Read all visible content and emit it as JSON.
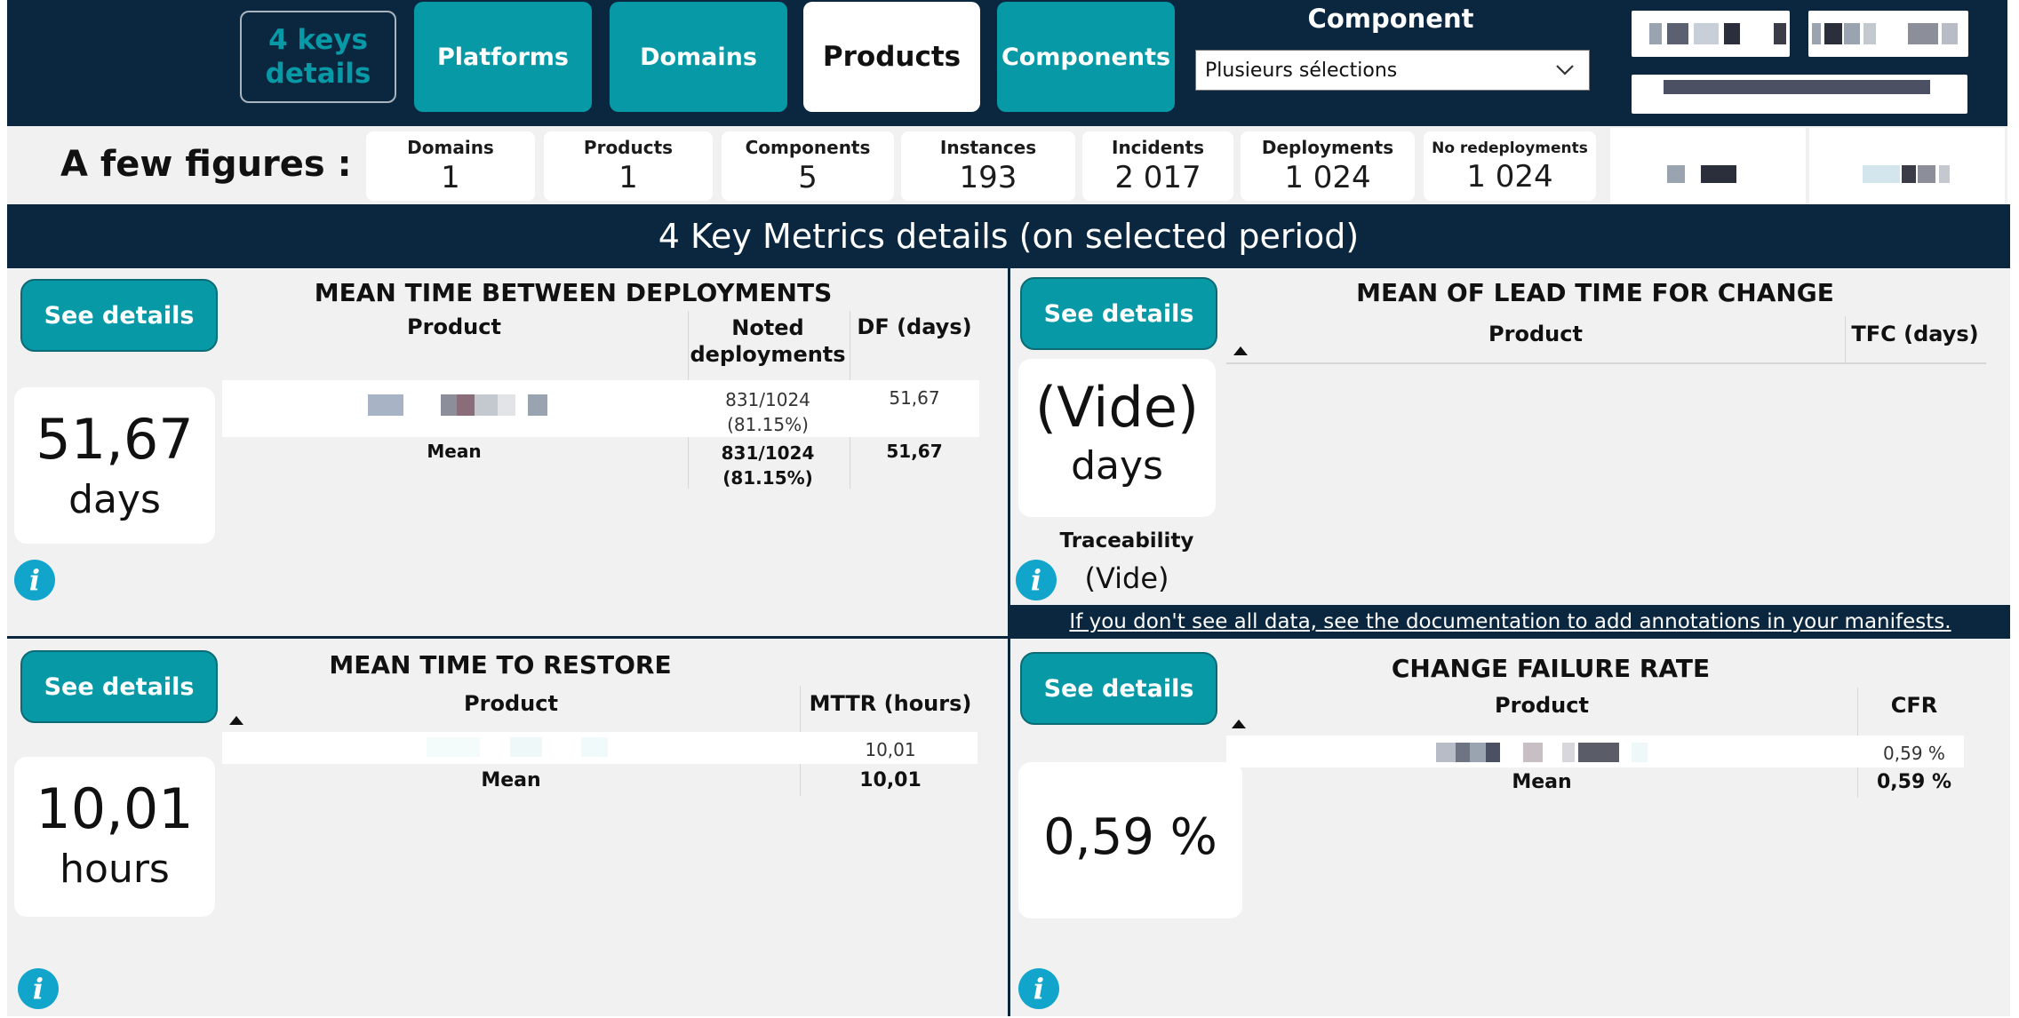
{
  "nav": {
    "keys_details": "4 keys details",
    "platforms": "Platforms",
    "domains": "Domains",
    "products": "Products",
    "components": "Components"
  },
  "filter": {
    "label": "Component",
    "value": "Plusieurs sélections"
  },
  "figures": {
    "title": "A few figures :",
    "cards": [
      {
        "label": "Domains",
        "value": "1"
      },
      {
        "label": "Products",
        "value": "1"
      },
      {
        "label": "Components",
        "value": "5"
      },
      {
        "label": "Instances",
        "value": "193"
      },
      {
        "label": "Incidents",
        "value": "2 017"
      },
      {
        "label": "Deployments",
        "value": "1 024"
      },
      {
        "label": "No redeployments",
        "value": "1 024"
      }
    ]
  },
  "banner": "4 Key Metrics details (on selected period)",
  "see_details": "See details",
  "mtbd": {
    "title": "MEAN TIME BETWEEN DEPLOYMENTS",
    "kpi_value": "51,67",
    "kpi_unit": "days",
    "col_product": "Product",
    "col_noted": "Noted deployments",
    "col_df": "DF (days)",
    "row_noted": "831/1024",
    "row_noted_pct": "(81.15%)",
    "row_df": "51,67",
    "mean_label": "Mean",
    "mean_noted": "831/1024",
    "mean_noted_pct": "(81.15%)",
    "mean_df": "51,67"
  },
  "ltfc": {
    "title": "MEAN OF LEAD TIME FOR CHANGE",
    "kpi_value": "(Vide)",
    "kpi_unit": "days",
    "col_product": "Product",
    "col_tfc": "TFC (days)",
    "traceability_label": "Traceability",
    "traceability_value": "(Vide)",
    "doc_link": "If you don't see all data, see the documentation to add annotations in your manifests."
  },
  "mttr": {
    "title": "MEAN TIME TO RESTORE",
    "kpi_value": "10,01",
    "kpi_unit": "hours",
    "col_product": "Product",
    "col_mttr": "MTTR (hours)",
    "row_mttr": "10,01",
    "mean_label": "Mean",
    "mean_mttr": "10,01"
  },
  "cfr": {
    "title": "CHANGE FAILURE RATE",
    "kpi_value": "0,59 %",
    "col_product": "Product",
    "col_cfr": "CFR",
    "row_cfr": "0,59 %",
    "mean_label": "Mean",
    "mean_cfr": "0,59 %"
  },
  "info_icon": "i",
  "colors": {
    "navy": "#0b2740",
    "teal": "#0899a6",
    "info": "#12a5cc",
    "panel": "#f1f1f1"
  }
}
